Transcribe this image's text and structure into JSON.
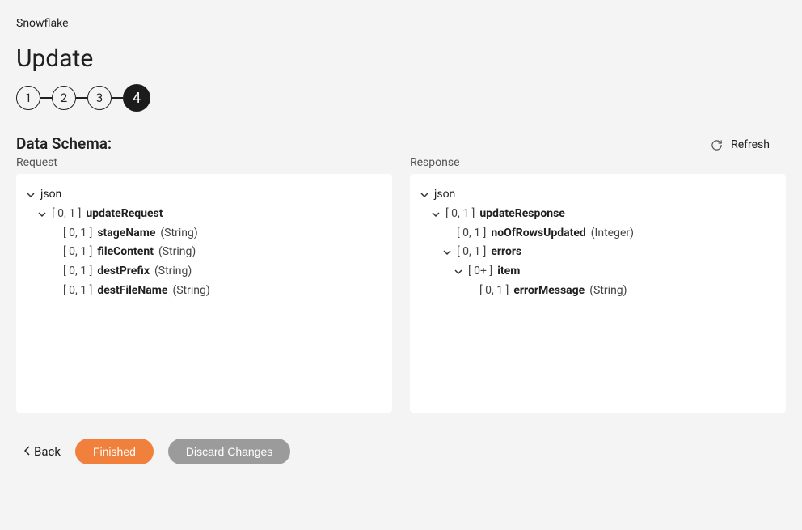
{
  "breadcrumb": "Snowflake",
  "page_title": "Update",
  "stepper": {
    "steps": [
      "1",
      "2",
      "3",
      "4"
    ],
    "active_index": 3
  },
  "section_title": "Data Schema:",
  "refresh_label": "Refresh",
  "columns": {
    "request": {
      "label": "Request"
    },
    "response": {
      "label": "Response"
    }
  },
  "request_tree": {
    "root": "json",
    "container": {
      "card": "[ 0, 1 ]",
      "name": "updateRequest"
    },
    "fields": [
      {
        "card": "[ 0, 1 ]",
        "name": "stageName",
        "type": "(String)"
      },
      {
        "card": "[ 0, 1 ]",
        "name": "fileContent",
        "type": "(String)"
      },
      {
        "card": "[ 0, 1 ]",
        "name": "destPrefix",
        "type": "(String)"
      },
      {
        "card": "[ 0, 1 ]",
        "name": "destFileName",
        "type": "(String)"
      }
    ]
  },
  "response_tree": {
    "root": "json",
    "container": {
      "card": "[ 0, 1 ]",
      "name": "updateResponse"
    },
    "rows_updated": {
      "card": "[ 0, 1 ]",
      "name": "noOfRowsUpdated",
      "type": "(Integer)"
    },
    "errors": {
      "card": "[ 0, 1 ]",
      "name": "errors"
    },
    "item": {
      "card": "[ 0+ ]",
      "name": "item"
    },
    "error_message": {
      "card": "[ 0, 1 ]",
      "name": "errorMessage",
      "type": "(String)"
    }
  },
  "footer": {
    "back": "Back",
    "finished": "Finished",
    "discard": "Discard Changes"
  }
}
